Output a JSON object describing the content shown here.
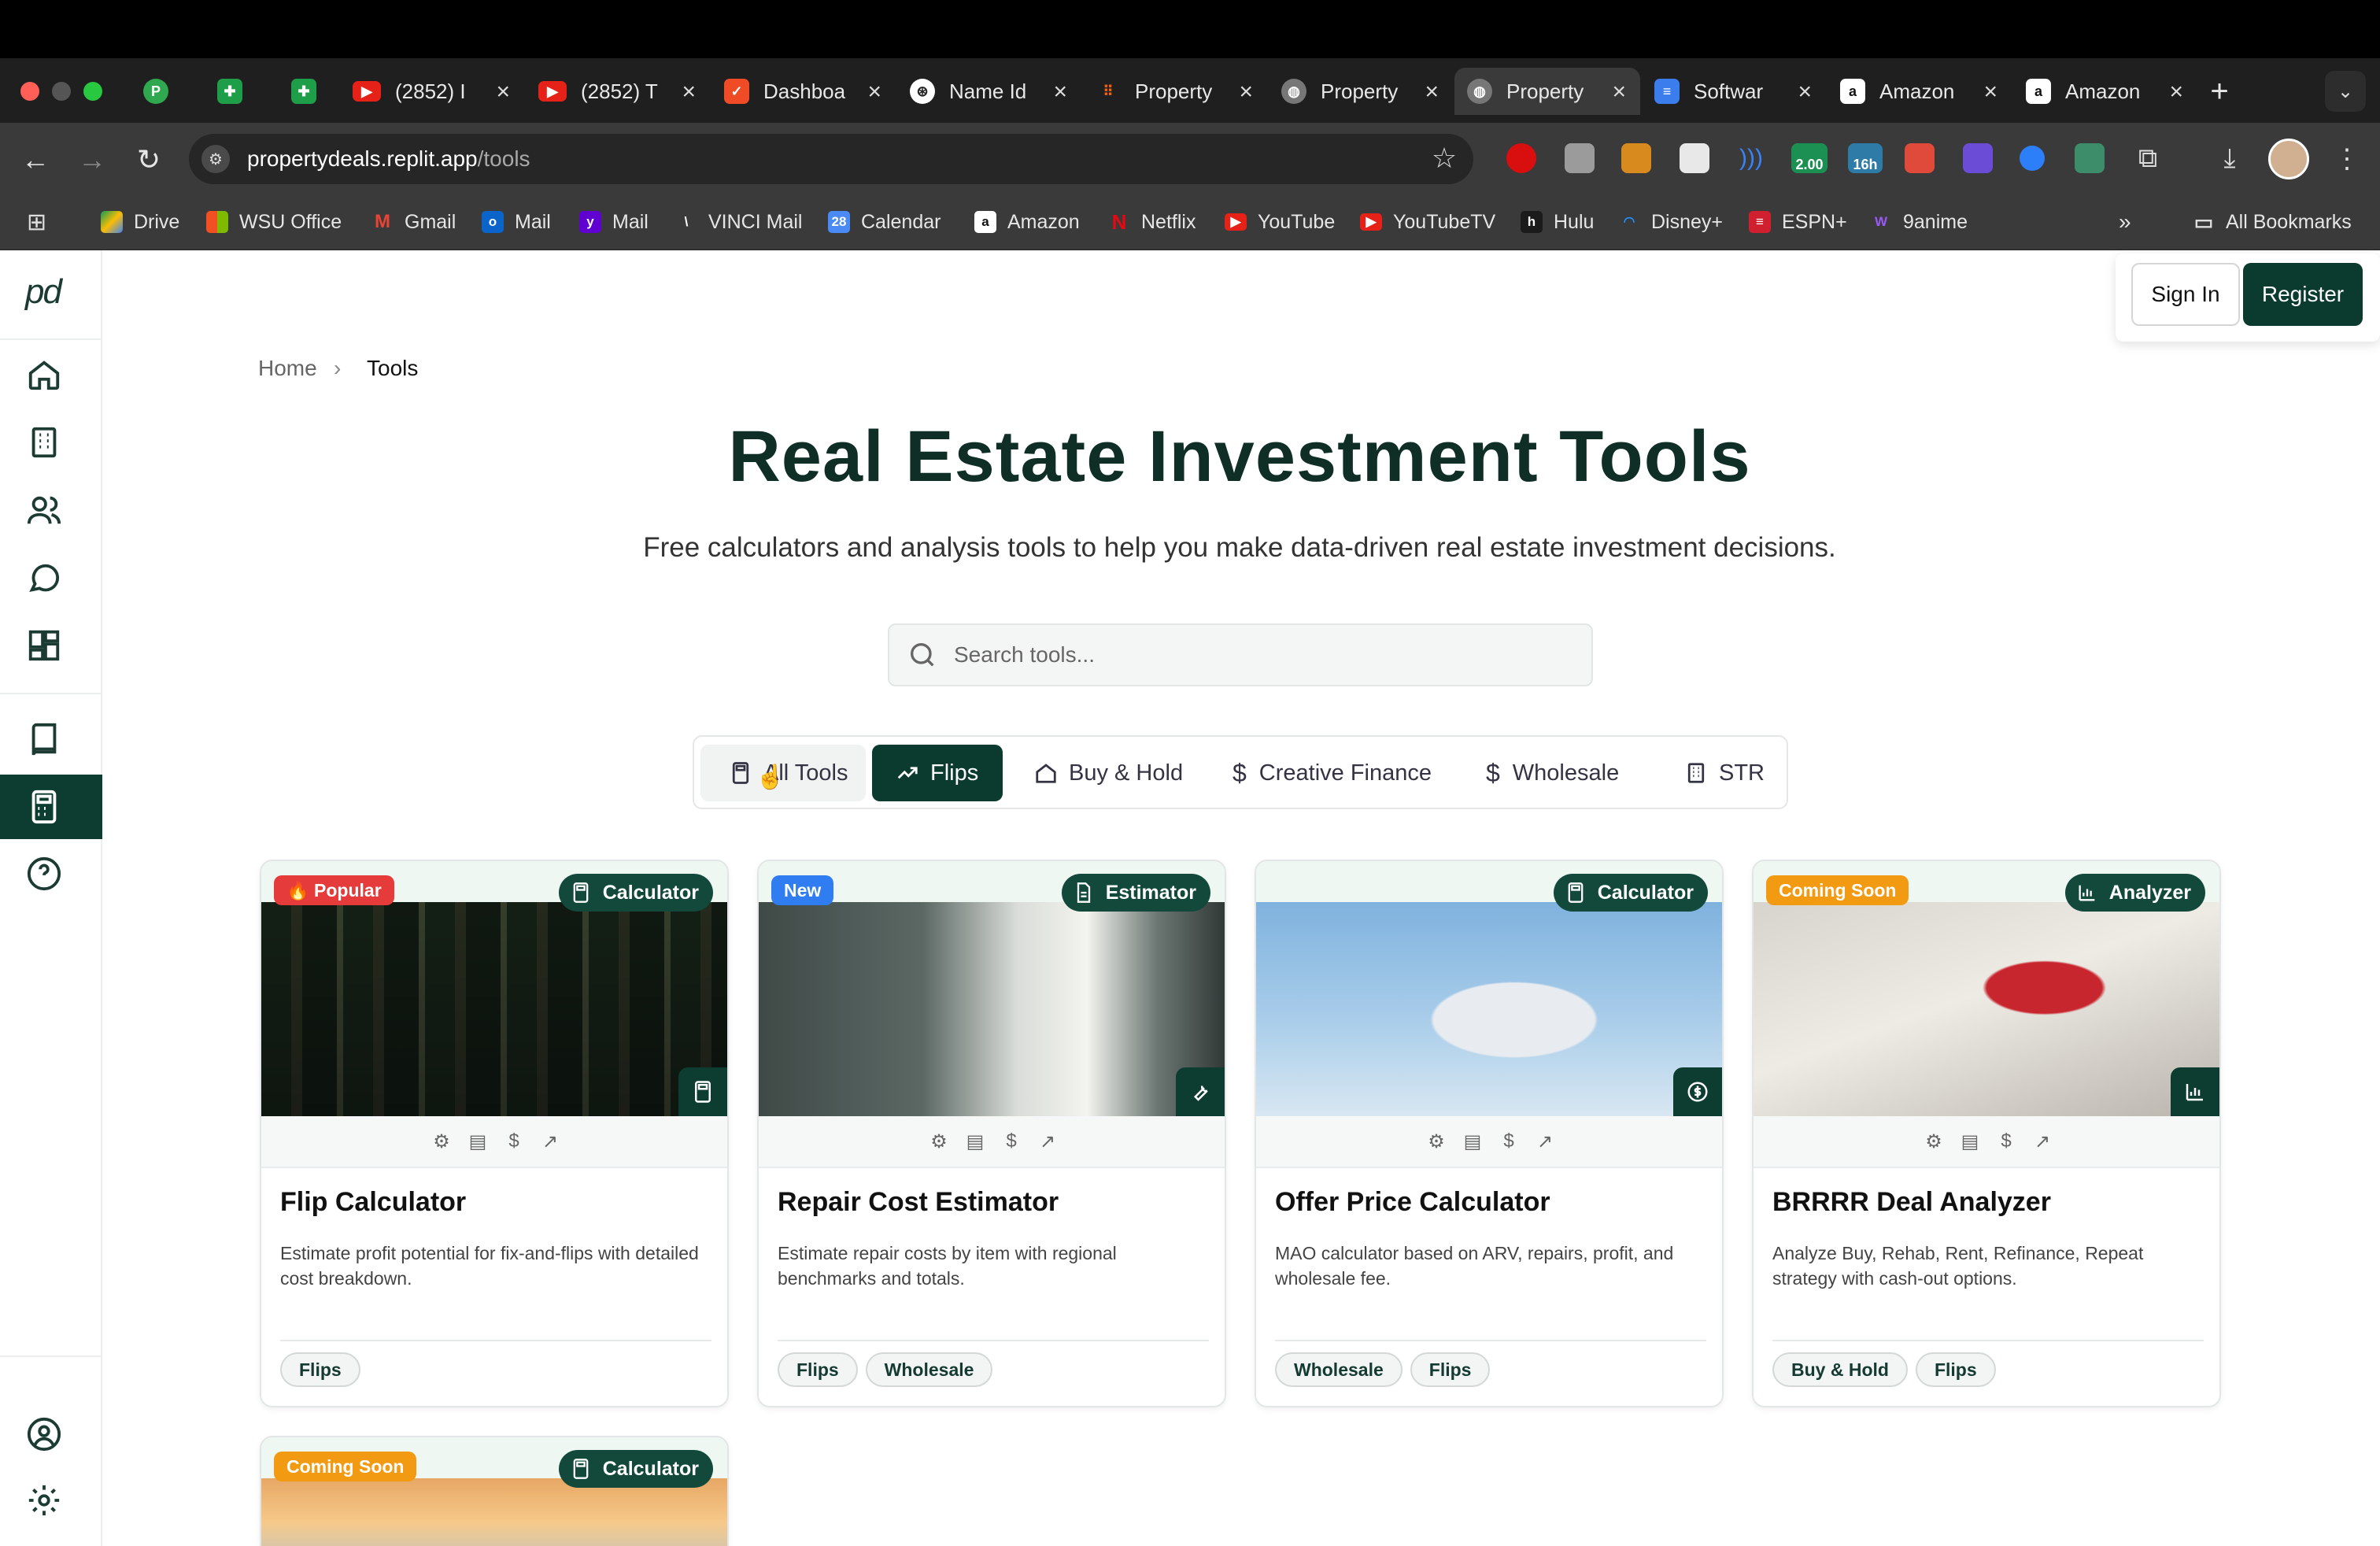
{
  "browser": {
    "tabs": [
      {
        "title": "",
        "icon": "p-circle-icon",
        "color": "#2fa84f"
      },
      {
        "title": "",
        "icon": "sheets-icon",
        "color": "#1e9e48"
      },
      {
        "title": "",
        "icon": "sheets-icon",
        "color": "#1e9e48"
      },
      {
        "title": "(2852) I",
        "icon": "youtube-icon",
        "color": "#e62117"
      },
      {
        "title": "(2852) T",
        "icon": "youtube-icon",
        "color": "#e62117"
      },
      {
        "title": "Dashboa",
        "icon": "dashboard-icon",
        "color": "#ef4b26"
      },
      {
        "title": "Name Id",
        "icon": "openai-icon",
        "color": "#444444"
      },
      {
        "title": "Property",
        "icon": "replit-icon",
        "color": "#f26207"
      },
      {
        "title": "Property",
        "icon": "globe-icon",
        "color": "#777777"
      },
      {
        "title": "Property",
        "icon": "globe-icon",
        "color": "#777777"
      },
      {
        "title": "Softwar",
        "icon": "docs-icon",
        "color": "#3b7ded"
      },
      {
        "title": "Amazon",
        "icon": "amazon-icon",
        "color": "#ffffff"
      },
      {
        "title": "Amazon",
        "icon": "amazon-icon",
        "color": "#ffffff"
      }
    ],
    "url_host": "propertydeals.replit.app",
    "url_path": "/tools",
    "ext_badges": {
      "a": "2.00",
      "b": "16h"
    },
    "bookmarks": [
      "Drive",
      "WSU Office",
      "Gmail",
      "Mail",
      "Mail",
      "VINCI Mail",
      "Calendar",
      "Amazon",
      "Netflix",
      "YouTube",
      "YouTubeTV",
      "Hulu",
      "Disney+",
      "ESPN+",
      "9anime"
    ],
    "all_bookmarks": "All Bookmarks",
    "overflow": "»"
  },
  "app": {
    "logo": "pd",
    "signin": "Sign In",
    "register": "Register",
    "breadcrumb": {
      "home": "Home",
      "sep": "›",
      "current": "Tools"
    },
    "title": "Real Estate Investment Tools",
    "subtitle": "Free calculators and analysis tools to help you make data-driven real estate investment decisions.",
    "search_placeholder": "Search tools...",
    "filters": [
      "All Tools",
      "Flips",
      "Buy & Hold",
      "Creative Finance",
      "Wholesale",
      "STR"
    ],
    "active_filter": "Flips",
    "cards": [
      {
        "badge": "🔥 Popular",
        "badge_color": "#e63b3b",
        "type": "Calculator",
        "title": "Flip Calculator",
        "desc": "Estimate profit potential for fix-and-flips with detailed cost breakdown.",
        "tags": [
          "Flips"
        ]
      },
      {
        "badge": "New",
        "badge_color": "#2f7df0",
        "type": "Estimator",
        "title": "Repair Cost Estimator",
        "desc": "Estimate repair costs by item with regional benchmarks and totals.",
        "tags": [
          "Flips",
          "Wholesale"
        ]
      },
      {
        "badge": "",
        "badge_color": "",
        "type": "Calculator",
        "title": "Offer Price Calculator",
        "desc": "MAO calculator based on ARV, repairs, profit, and wholesale fee.",
        "tags": [
          "Wholesale",
          "Flips"
        ]
      },
      {
        "badge": "Coming Soon",
        "badge_color": "#f29b12",
        "type": "Analyzer",
        "title": "BRRRR Deal Analyzer",
        "desc": "Analyze Buy, Rehab, Rent, Refinance, Repeat strategy with cash-out options.",
        "tags": [
          "Buy & Hold",
          "Flips"
        ]
      },
      {
        "badge": "Coming Soon",
        "badge_color": "#f29b12",
        "type": "Calculator"
      }
    ]
  }
}
